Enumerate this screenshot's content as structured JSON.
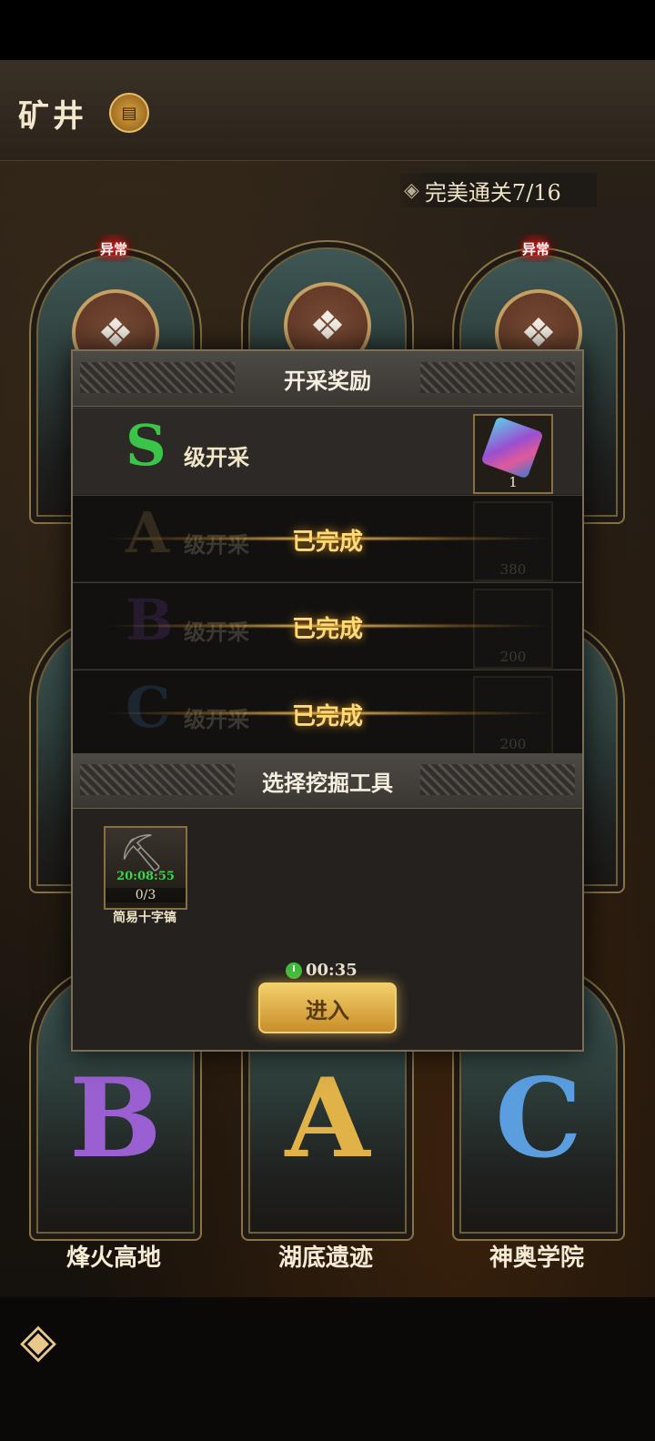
{
  "header": {
    "title": "矿井",
    "badge_icon": "scroll-icon"
  },
  "progress": {
    "label": "完美通关7/16",
    "completed": 7,
    "total": 16
  },
  "tags": {
    "abnormal": "异常"
  },
  "modal": {
    "title": "开采奖励",
    "rewards": [
      {
        "grade": "S",
        "label": "级开采",
        "color": "#3bc548",
        "item_count": "1",
        "status": ""
      },
      {
        "grade": "A",
        "label": "级开采",
        "color": "#c9a45a",
        "item_count": "380",
        "status": "已完成"
      },
      {
        "grade": "B",
        "label": "级开采",
        "color": "#7c47b8",
        "item_count": "200",
        "status": "已完成"
      },
      {
        "grade": "C",
        "label": "级开采",
        "color": "#4a86c7",
        "item_count": "200",
        "status": "已完成"
      }
    ],
    "tool_section_title": "选择挖掘工具",
    "tool": {
      "timer": "20:08:55",
      "count": "0/3",
      "name": "简易十字镐"
    },
    "countdown": "00:35",
    "enter_label": "进入"
  },
  "cards": [
    {
      "letter": "B",
      "color": "#9a5fd0",
      "label": "烽火高地"
    },
    {
      "letter": "A",
      "color": "#e0b248",
      "label": "湖底遗迹"
    },
    {
      "letter": "C",
      "color": "#5a9ee0",
      "label": "神奥学院"
    }
  ]
}
